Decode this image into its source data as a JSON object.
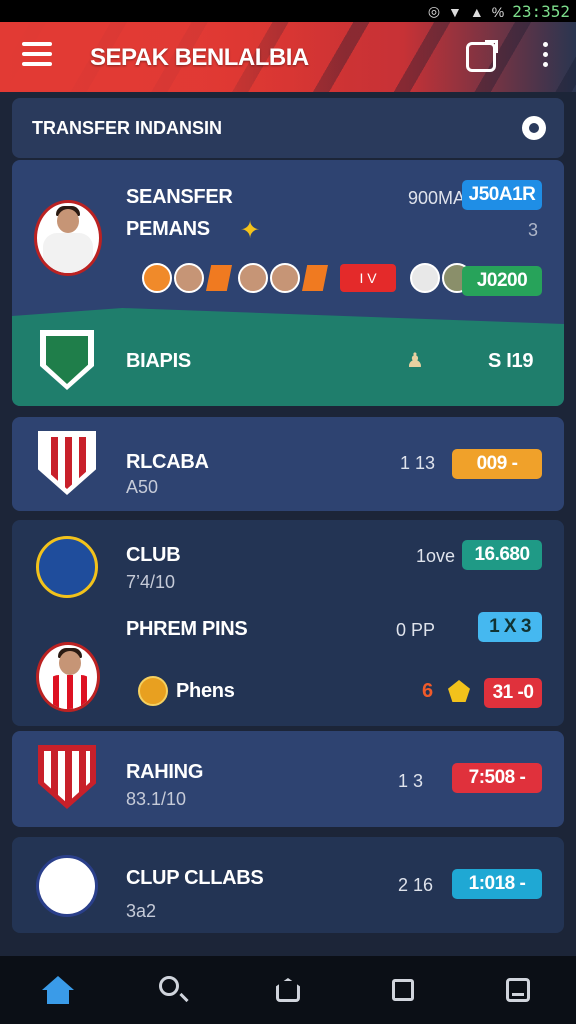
{
  "status_bar": {
    "time": "23:352",
    "battery": "%"
  },
  "app_bar": {
    "title": "SEPAK BENLALBIA"
  },
  "section": {
    "title": "TRANSFER INDANSIN"
  },
  "featured": {
    "line1": "SEANSFER",
    "line2": "PEMANS",
    "amount": "900MA",
    "tag": "J50A1R",
    "tag_color": "#1f8ee6",
    "side_value": "3",
    "mini_tag": "I V",
    "total": "J0200",
    "total_color": "#27a35a",
    "club": "BIAPIS",
    "club_value": "S I19"
  },
  "rows": [
    {
      "name": "RLCABA",
      "sub": "A50",
      "count": "1 13",
      "badge": "009 -",
      "badge_color": "#f0a12a"
    },
    {
      "name": "CLUB",
      "sub": "7’4/10",
      "count": "1ove",
      "badge": "16.680",
      "badge_color": "#1f9a86"
    },
    {
      "name": "RAHING",
      "sub": "83.1/10",
      "count": "1 3",
      "badge": "7:508 -",
      "badge_color": "#e0313c"
    },
    {
      "name": "CLUP CLLABS",
      "sub": "3a2",
      "count": "2 16",
      "badge": "1:018 -",
      "badge_color": "#1fa8d4"
    }
  ],
  "club_extra": {
    "label": "PHREM PINS",
    "count": "0 PP",
    "badge": "1 X 3",
    "badge_color": "#45b8f0",
    "player_label": "Phens",
    "player_count": "6",
    "player_badge": "31 -0",
    "player_badge_color": "#e0313c"
  },
  "icons": {
    "menu": "menu-icon",
    "sync": "sync-icon",
    "more": "more-vert-icon",
    "settings": "gear-icon",
    "home": "home-icon",
    "search": "search-icon",
    "home_outline": "home-outline-icon",
    "square": "square-icon",
    "tray": "tray-icon"
  },
  "colors": {
    "accent_red": "#e23a34",
    "card_blue": "#2e4371",
    "card_green": "#1f7e6c",
    "background": "#1c2538"
  }
}
